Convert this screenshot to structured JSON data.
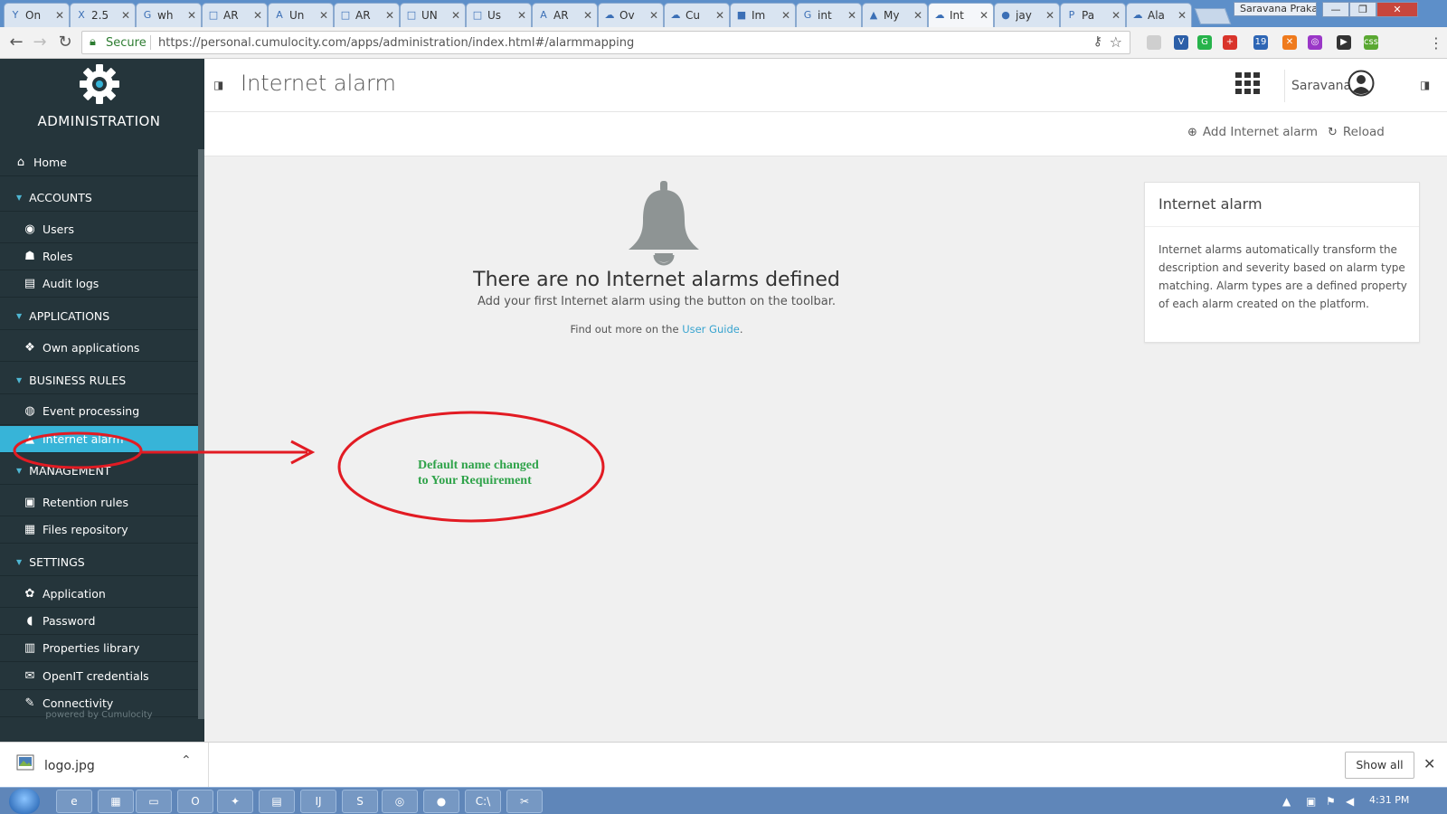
{
  "browser": {
    "tabs": [
      {
        "icon": "Y",
        "title": "On"
      },
      {
        "icon": "X",
        "title": "2.5"
      },
      {
        "icon": "G",
        "title": "wh"
      },
      {
        "icon": "□",
        "title": "AR"
      },
      {
        "icon": "A",
        "title": "Un"
      },
      {
        "icon": "□",
        "title": "AR"
      },
      {
        "icon": "□",
        "title": "UN"
      },
      {
        "icon": "□",
        "title": "Us"
      },
      {
        "icon": "A",
        "title": "AR"
      },
      {
        "icon": "☁",
        "title": "Ov"
      },
      {
        "icon": "☁",
        "title": "Cu"
      },
      {
        "icon": "■",
        "title": "Im"
      },
      {
        "icon": "G",
        "title": "int"
      },
      {
        "icon": "▲",
        "title": "My"
      },
      {
        "icon": "☁",
        "title": "Int"
      },
      {
        "icon": "●",
        "title": "jay"
      },
      {
        "icon": "P",
        "title": "Pa"
      },
      {
        "icon": "☁",
        "title": "Ala"
      }
    ],
    "active_tab": 14,
    "profile": "Saravana Praka...",
    "secure_label": "Secure",
    "url": "https://personal.cumulocity.com/apps/administration/index.html#/alarmmapping",
    "extensions": [
      {
        "icon": "ext-grey-icon",
        "color": "#cfcfcf",
        "label": ""
      },
      {
        "icon": "ext-v-icon",
        "color": "#2c5fa8",
        "label": "V"
      },
      {
        "icon": "ext-grammarly-icon",
        "color": "#27b34b",
        "label": "G"
      },
      {
        "icon": "ext-red-icon",
        "color": "#d9342b",
        "label": "+"
      },
      {
        "icon": "ext-cloud-icon",
        "color": "#2e66b5",
        "label": "19"
      },
      {
        "icon": "ext-orange-icon",
        "color": "#ef7a1c",
        "label": "✕"
      },
      {
        "icon": "ext-purple-icon",
        "color": "#9a37c7",
        "label": "◎"
      },
      {
        "icon": "ext-pin-icon",
        "color": "#333333",
        "label": "▶"
      },
      {
        "icon": "ext-green-icon",
        "color": "#5aa832",
        "label": "css"
      }
    ]
  },
  "sidebar": {
    "title": "ADMINISTRATION",
    "powered_by": "powered by Cumulocity",
    "items": [
      {
        "type": "item",
        "icon": "home-icon",
        "glyph": "⌂",
        "label": "Home",
        "home": true
      },
      {
        "type": "section",
        "label": "ACCOUNTS"
      },
      {
        "type": "item",
        "icon": "user-icon",
        "glyph": "◉",
        "label": "Users"
      },
      {
        "type": "item",
        "icon": "roles-icon",
        "glyph": "☗",
        "label": "Roles"
      },
      {
        "type": "item",
        "icon": "audit-icon",
        "glyph": "▤",
        "label": "Audit logs"
      },
      {
        "type": "section",
        "label": "APPLICATIONS"
      },
      {
        "type": "item",
        "icon": "applications-icon",
        "glyph": "❖",
        "label": "Own applications"
      },
      {
        "type": "section",
        "label": "BUSINESS RULES"
      },
      {
        "type": "item",
        "icon": "event-processing-icon",
        "glyph": "◍",
        "label": "Event processing"
      },
      {
        "type": "item",
        "icon": "bell-icon",
        "glyph": "▲",
        "label": "Internet alarm",
        "active": true
      },
      {
        "type": "section",
        "label": "MANAGEMENT"
      },
      {
        "type": "item",
        "icon": "retention-icon",
        "glyph": "▣",
        "label": "Retention rules"
      },
      {
        "type": "item",
        "icon": "files-icon",
        "glyph": "▦",
        "label": "Files repository"
      },
      {
        "type": "section",
        "label": "SETTINGS"
      },
      {
        "type": "item",
        "icon": "gear-icon",
        "glyph": "✿",
        "label": "Application"
      },
      {
        "type": "item",
        "icon": "shield-icon",
        "glyph": "◖",
        "label": "Password"
      },
      {
        "type": "item",
        "icon": "book-icon",
        "glyph": "▥",
        "label": "Properties library"
      },
      {
        "type": "item",
        "icon": "envelope-icon",
        "glyph": "✉",
        "label": "OpenIT credentials"
      },
      {
        "type": "item",
        "icon": "connectivity-icon",
        "glyph": "✎",
        "label": "Connectivity"
      }
    ]
  },
  "header": {
    "title": "Internet alarm",
    "user": "Saravana"
  },
  "actions": {
    "add_label": "Add Internet alarm",
    "reload_label": "Reload"
  },
  "empty_state": {
    "title": "There are no Internet alarms defined",
    "subtitle": "Add your first Internet alarm using the button on the toolbar.",
    "guide_prefix": "Find out more on the ",
    "guide_link": "User Guide",
    "guide_suffix": "."
  },
  "info_card": {
    "title": "Internet alarm",
    "body": "Internet alarms automatically transform the description and severity based on alarm type matching. Alarm types are a defined property of each alarm created on the platform."
  },
  "annotation": {
    "text": "Default name changed to Your Requirement",
    "color": "#2fa34a",
    "stroke": "#e21b23"
  },
  "downloads": {
    "file": "logo.jpg",
    "show_all": "Show all"
  },
  "taskbar": {
    "apps": [
      {
        "icon": "ie-icon",
        "glyph": "e"
      },
      {
        "icon": "app-red-icon",
        "glyph": "▦"
      },
      {
        "icon": "explorer-icon",
        "glyph": "▭"
      },
      {
        "icon": "outlook-icon",
        "glyph": "O"
      },
      {
        "icon": "paint-icon",
        "glyph": "✦"
      },
      {
        "icon": "folder-icon",
        "glyph": "▤"
      },
      {
        "icon": "intellij-icon",
        "glyph": "IJ"
      },
      {
        "icon": "sublime-icon",
        "glyph": "S"
      },
      {
        "icon": "chrome-icon",
        "glyph": "◎"
      },
      {
        "icon": "postman-icon",
        "glyph": "●"
      },
      {
        "icon": "cmd-icon",
        "glyph": "C:\\"
      },
      {
        "icon": "snip-icon",
        "glyph": "✂"
      }
    ],
    "time": "4:31 PM"
  }
}
